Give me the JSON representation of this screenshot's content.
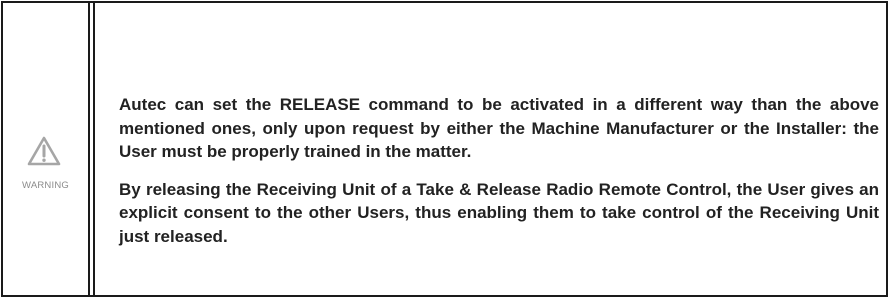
{
  "warning": {
    "icon": "warning-triangle-icon",
    "label": "WARNING",
    "colors": {
      "border": "#1a1a1a",
      "icon": "#a6a6a6",
      "label": "#8c8c8c",
      "text": "#222222"
    }
  },
  "paragraphs": [
    "Autec can set the RELEASE command to be activated in a different way than the above mentioned ones, only upon request by either the Machine Manufacturer or the Installer: the User must be properly trained in the matter.",
    "By releasing the Receiving Unit of a Take & Release Radio Remote Control, the User gives an explicit consent to the other Users, thus enabling them to take control of the Receiving Unit just released."
  ]
}
